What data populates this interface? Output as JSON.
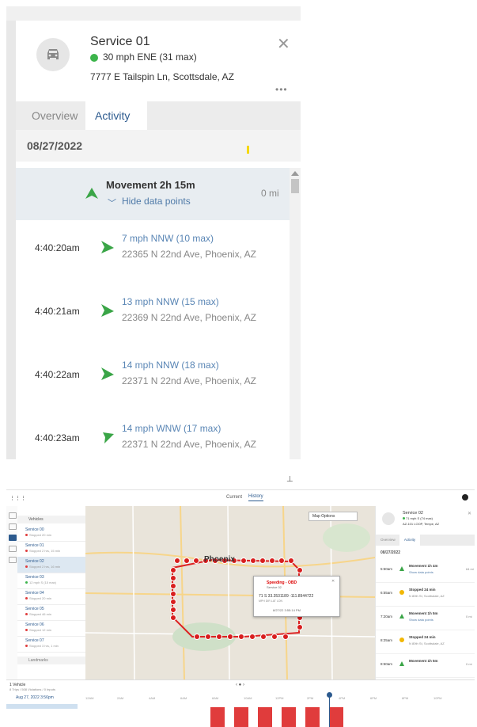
{
  "top": {
    "vehicle": {
      "name": "Service 01",
      "speed": "30 mph ENE (31 max)",
      "address": "7777 E Tailspin Ln, Scottsdale, AZ",
      "status_color": "#3cb44b"
    },
    "tabs": [
      {
        "label": "Overview",
        "active": false
      },
      {
        "label": "Activity",
        "active": true
      }
    ],
    "date": "08/27/2022",
    "movement": {
      "title": "Movement 2h 15m",
      "toggle": "Hide data points",
      "distance": "0 mi"
    },
    "data_points": [
      {
        "time": "4:40:20am",
        "speed": "7 mph NNW (10 max)",
        "address": "22365 N 22nd Ave, Phoenix, AZ",
        "direction": "NNW"
      },
      {
        "time": "4:40:21am",
        "speed": "13 mph NNW (15 max)",
        "address": "22369 N 22nd Ave, Phoenix, AZ",
        "direction": "NNW"
      },
      {
        "time": "4:40:22am",
        "speed": "14 mph NNW (18 max)",
        "address": "22371 N 22nd Ave, Phoenix, AZ",
        "direction": "NNW"
      },
      {
        "time": "4:40:23am",
        "speed": "14 mph WNW (17 max)",
        "address": "22371 N 22nd Ave, Phoenix, AZ",
        "direction": "WNW"
      }
    ]
  },
  "bottom": {
    "topbar": {
      "current": "Current",
      "history": "History"
    },
    "list": {
      "vehicles_label": "Vehicles",
      "items": [
        {
          "name": "Service 00",
          "sub": "Stopped 20 min",
          "dot": "#e03c3c"
        },
        {
          "name": "Service 01",
          "sub": "Stopped 2 hrs, 15 min",
          "dot": "#e03c3c"
        },
        {
          "name": "Service 02",
          "sub": "Stopped 2 hrs, 16 min",
          "dot": "#e03c3c"
        },
        {
          "name": "Service 03",
          "sub": "12 mph S (15 max)",
          "dot": "#3cb44b"
        },
        {
          "name": "Service 04",
          "sub": "Stopped 20 min",
          "dot": "#e03c3c"
        },
        {
          "name": "Service 05",
          "sub": "Stopped 46 min",
          "dot": "#e03c3c"
        },
        {
          "name": "Service 06",
          "sub": "Stopped 12 min",
          "dot": "#e03c3c"
        },
        {
          "name": "Service 07",
          "sub": "Stopped 3 hrs, 1 min",
          "dot": "#e03c3c"
        }
      ],
      "landmarks_label": "Landmarks"
    },
    "map": {
      "options": "Map Options",
      "city": "Phoenix",
      "popup": {
        "title": "Speeding - OBD",
        "subtitle": "Service 02",
        "values": "71    S    33.3531189   -111.8944722",
        "labels": "MPH    DIR        LAT                LON",
        "time": "8/27/22 3:55:14 PM"
      }
    },
    "side": {
      "name": "Service 02",
      "speed": "71 mph S (74 max)",
      "address": "AZ-101 LOOP, Tempe, AZ",
      "tabs": [
        "Overview",
        "Activity"
      ],
      "date": "08/27/2022",
      "rows": [
        {
          "time": "5:50am",
          "title": "Movement 1h 4m",
          "sub": "Show data points",
          "dist": "64 mi",
          "kind": "move"
        },
        {
          "time": "6:55am",
          "title": "Stopped 24 min",
          "sub": "N 80th St, Scottsdale, AZ",
          "dist": "",
          "kind": "stop"
        },
        {
          "time": "7:20am",
          "title": "Movement 1h 5m",
          "sub": "Show data points",
          "dist": "0 mi",
          "kind": "move"
        },
        {
          "time": "8:25am",
          "title": "Stopped 24 min",
          "sub": "N 80th St, Scottsdale, AZ",
          "dist": "",
          "kind": "stop"
        },
        {
          "time": "8:50am",
          "title": "Movement 1h 5m",
          "sub": "",
          "dist": "0 mi",
          "kind": "move"
        }
      ]
    },
    "timeline": {
      "vehicle": "1 Vehicle",
      "vehicle_sub": "8 Trips / 508 Violations / 0 Inputs",
      "date": "Aug 27, 2022  3:56pm",
      "ticks": [
        "12AM",
        "2AM",
        "4AM",
        "6AM",
        "8AM",
        "10AM",
        "12PM",
        "2PM",
        "4PM",
        "6PM",
        "8PM",
        "10PM"
      ]
    }
  }
}
